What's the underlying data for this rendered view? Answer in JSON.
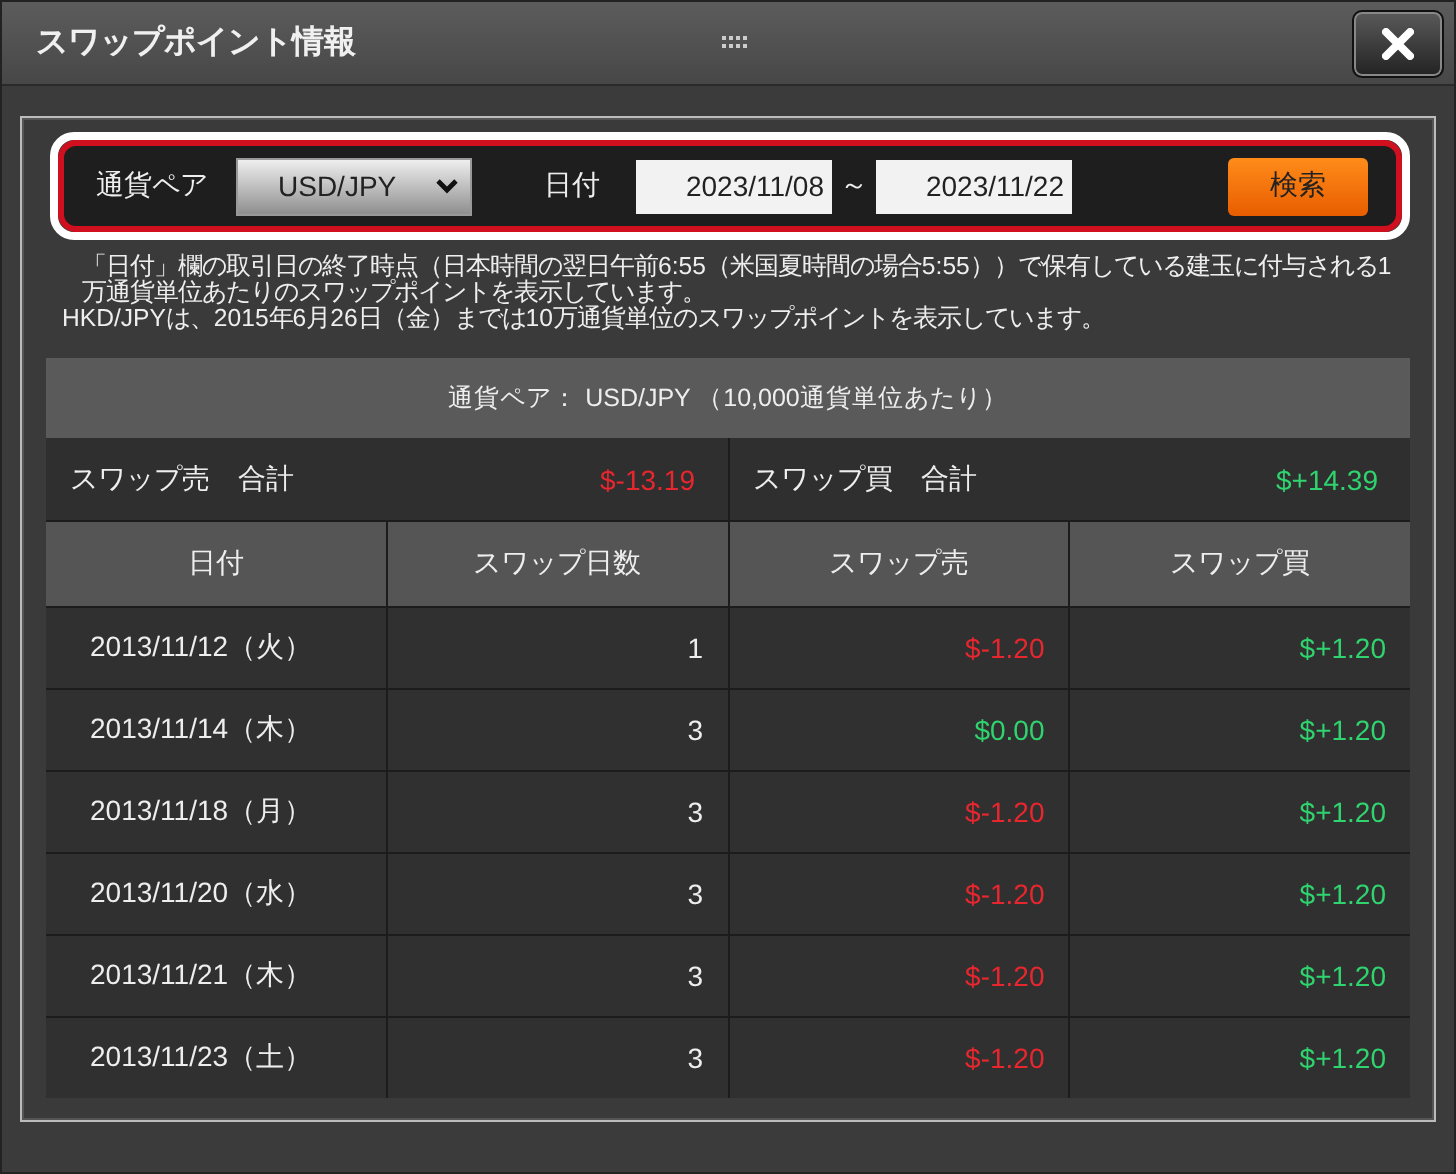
{
  "window": {
    "title": "スワップポイント情報"
  },
  "filter": {
    "pair_label": "通貨ペア",
    "pair": "USD/JPY",
    "date_label": "日付",
    "from": "2023/11/08",
    "separator": "～",
    "to": "2023/11/22",
    "search_button": "検索"
  },
  "notes": [
    "「日付」欄の取引日の終了時点（日本時間の翌日午前6:55（米国夏時間の場合5:55））で保有している建玉に付与される1万通貨単位あたりのスワップポイントを表示しています。",
    "HKD/JPYは、2015年6月26日（金）までは10万通貨単位のスワップポイントを表示しています。"
  ],
  "summary": {
    "caption": "通貨ペア： USD/JPY （10,000通貨単位あたり）",
    "sell_label": "スワップ売　合計",
    "sell_total": {
      "text": "$-13.19",
      "color": "#e8262e"
    },
    "buy_label": "スワップ買　合計",
    "buy_total": {
      "text": "$+14.39",
      "color": "#2fd46f"
    }
  },
  "table": {
    "columns": [
      "日付",
      "スワップ日数",
      "スワップ売",
      "スワップ買"
    ],
    "rows": [
      {
        "date": "2013/11/12（火）",
        "days": "1",
        "sell": {
          "text": "$-1.20",
          "color": "#e8262e"
        },
        "buy": {
          "text": "$+1.20",
          "color": "#2fd46f"
        }
      },
      {
        "date": "2013/11/14（木）",
        "days": "3",
        "sell": {
          "text": "$0.00",
          "color": "#2fd46f"
        },
        "buy": {
          "text": "$+1.20",
          "color": "#2fd46f"
        }
      },
      {
        "date": "2013/11/18（月）",
        "days": "3",
        "sell": {
          "text": "$-1.20",
          "color": "#e8262e"
        },
        "buy": {
          "text": "$+1.20",
          "color": "#2fd46f"
        }
      },
      {
        "date": "2013/11/20（水）",
        "days": "3",
        "sell": {
          "text": "$-1.20",
          "color": "#e8262e"
        },
        "buy": {
          "text": "$+1.20",
          "color": "#2fd46f"
        }
      },
      {
        "date": "2013/11/21（木）",
        "days": "3",
        "sell": {
          "text": "$-1.20",
          "color": "#e8262e"
        },
        "buy": {
          "text": "$+1.20",
          "color": "#2fd46f"
        }
      },
      {
        "date": "2013/11/23（土）",
        "days": "3",
        "sell": {
          "text": "$-1.20",
          "color": "#e8262e"
        },
        "buy": {
          "text": "$+1.20",
          "color": "#2fd46f"
        }
      }
    ]
  }
}
